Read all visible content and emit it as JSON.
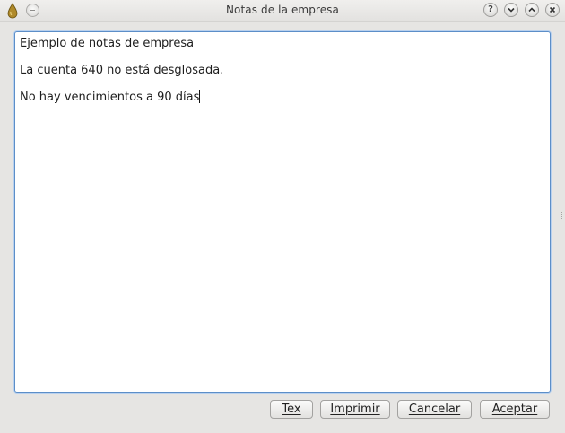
{
  "window": {
    "title": "Notas de la empresa"
  },
  "titlebar": {
    "app_icon": "drop-icon",
    "menu_button": "window-menu-icon",
    "buttons": [
      {
        "name": "help",
        "icon": "question-icon",
        "symbol": "?"
      },
      {
        "name": "minimize",
        "icon": "chevron-down-icon"
      },
      {
        "name": "maximize",
        "icon": "chevron-up-icon"
      },
      {
        "name": "close",
        "icon": "close-icon"
      }
    ]
  },
  "editor": {
    "lines": [
      "Ejemplo de notas de empresa",
      "La cuenta 640 no está desglosada.",
      "No hay vencimientos a 90 días"
    ]
  },
  "buttons": {
    "tex": "Tex",
    "imprimir": "Imprimir",
    "cancelar": "Cancelar",
    "aceptar": "Aceptar"
  },
  "colors": {
    "focus_border": "#5c8ec8",
    "window_bg": "#e6e5e3",
    "app_icon": "#b08a2a"
  }
}
